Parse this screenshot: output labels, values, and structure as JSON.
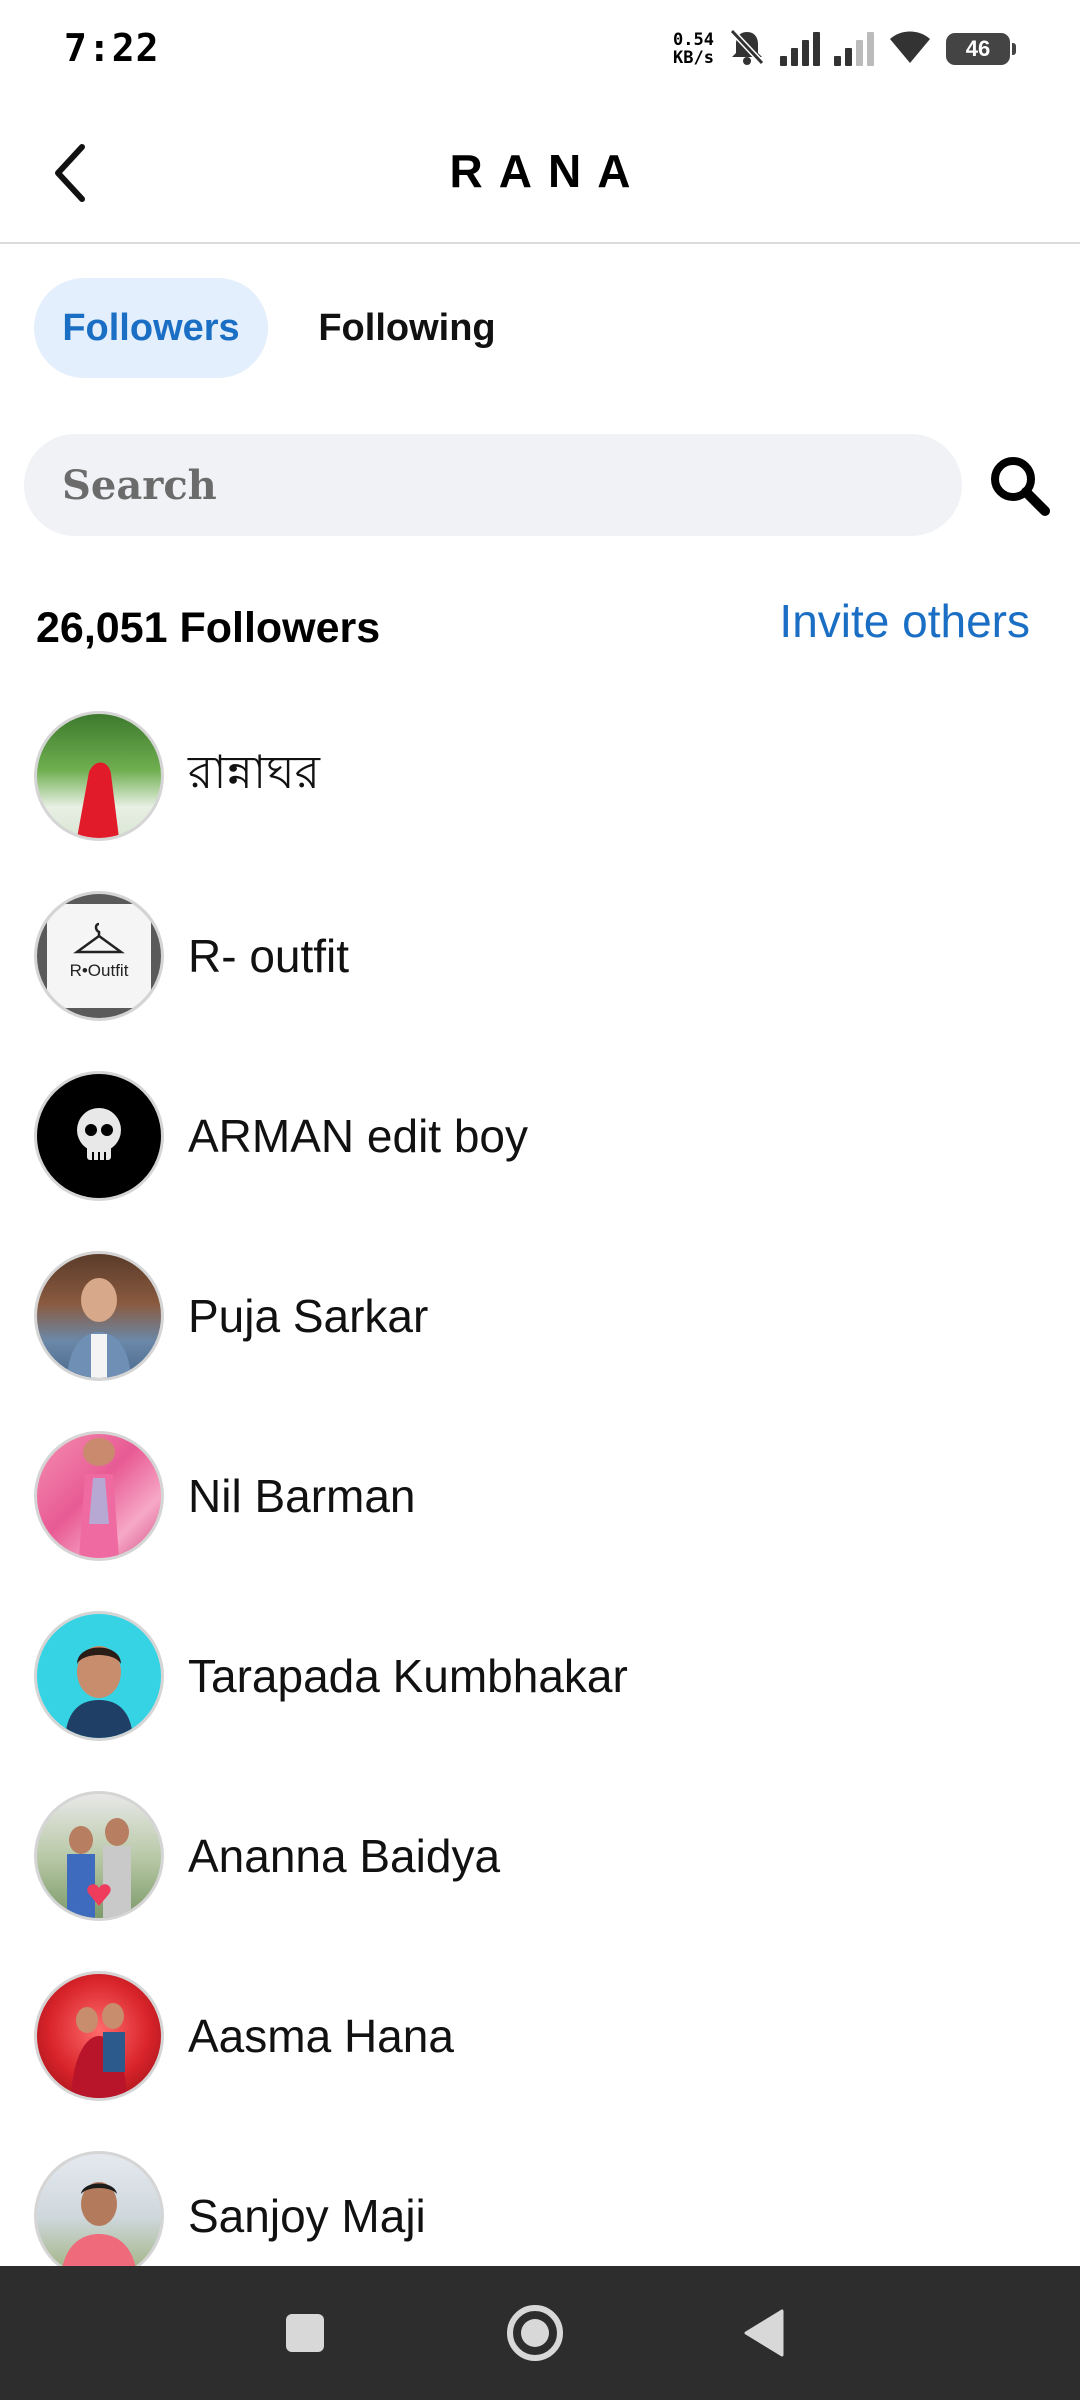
{
  "status_bar": {
    "time": "7:22",
    "net_speed_value": "0.54",
    "net_speed_unit": "KB/s",
    "battery": "46",
    "icons": [
      "bell-off-icon",
      "signal-icon",
      "signal-icon",
      "wifi-icon",
      "battery-icon"
    ]
  },
  "header": {
    "title": "RANA",
    "back_icon": "chevron-left-icon"
  },
  "tabs": [
    {
      "label": "Followers",
      "selected": true
    },
    {
      "label": "Following",
      "selected": false
    }
  ],
  "search": {
    "placeholder": "Search",
    "icon": "search-icon"
  },
  "summary": {
    "count_label": "26,051 Followers",
    "invite_label": "Invite others"
  },
  "followers": [
    {
      "name": "রান্নাঘর",
      "avatar": "photo"
    },
    {
      "name": "R- outfit",
      "avatar": "logo"
    },
    {
      "name": "ARMAN edit boy",
      "avatar": "skull"
    },
    {
      "name": "Puja Sarkar",
      "avatar": "photo"
    },
    {
      "name": "Nil Barman",
      "avatar": "photo"
    },
    {
      "name": "Tarapada Kumbhakar",
      "avatar": "photo"
    },
    {
      "name": "Ananna Baidya",
      "avatar": "photo"
    },
    {
      "name": "Aasma Hana",
      "avatar": "photo"
    },
    {
      "name": "Sanjoy Maji",
      "avatar": "photo"
    }
  ],
  "avatar_logo_text": "R•Outfit",
  "colors": {
    "accent": "#1a6fc4",
    "tab_selected_bg": "#e3effc",
    "search_bg": "#f0f2f5",
    "nav_bar_bg": "#2d2d2d"
  },
  "nav_bar": {
    "buttons": [
      "recents-square-icon",
      "home-circle-icon",
      "back-triangle-icon"
    ]
  }
}
